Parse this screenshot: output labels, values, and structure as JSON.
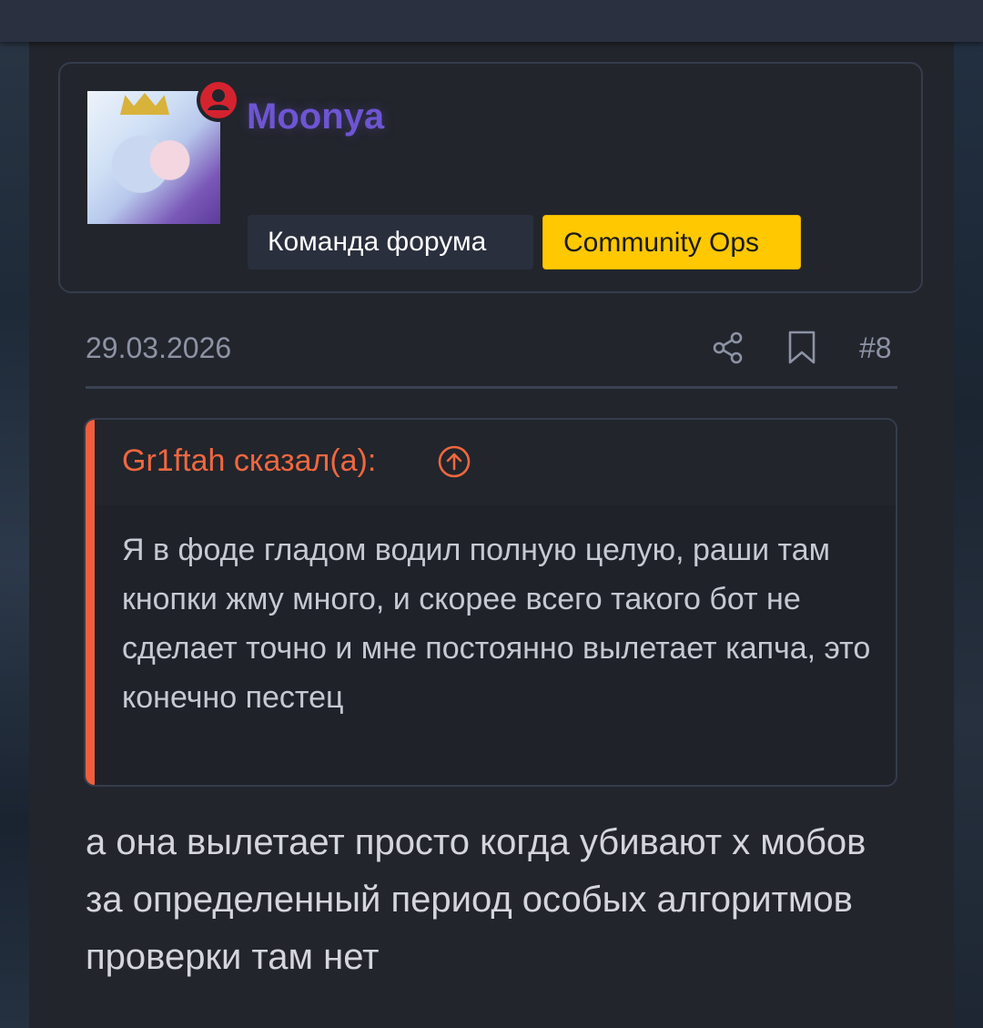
{
  "post": {
    "author": {
      "name": "Moonya",
      "name_color": "#6e55d2",
      "status_icon": "online-indicator-icon",
      "badges": [
        {
          "label": "Команда форума"
        },
        {
          "label": "Community Ops",
          "color": "#ffc800"
        }
      ]
    },
    "meta": {
      "date": "29.03.2026",
      "share_icon": "share-icon",
      "bookmark_icon": "bookmark-icon",
      "number": "#8"
    },
    "quote": {
      "author_line": "Gr1ftah сказал(а):",
      "accent_color": "#f05e3c",
      "jump_icon": "arrow-up-circle-icon",
      "text": "Я в фоде гладом водил полную целую, раши там кнопки жму много, и скорее всего такого бот не сделает точно и мне постоянно вылетает капча, это конечно пестец"
    },
    "message": {
      "text": "а она вылетает просто когда убивают х мобов за определенный период особых алгоритмов проверки там нет"
    }
  }
}
